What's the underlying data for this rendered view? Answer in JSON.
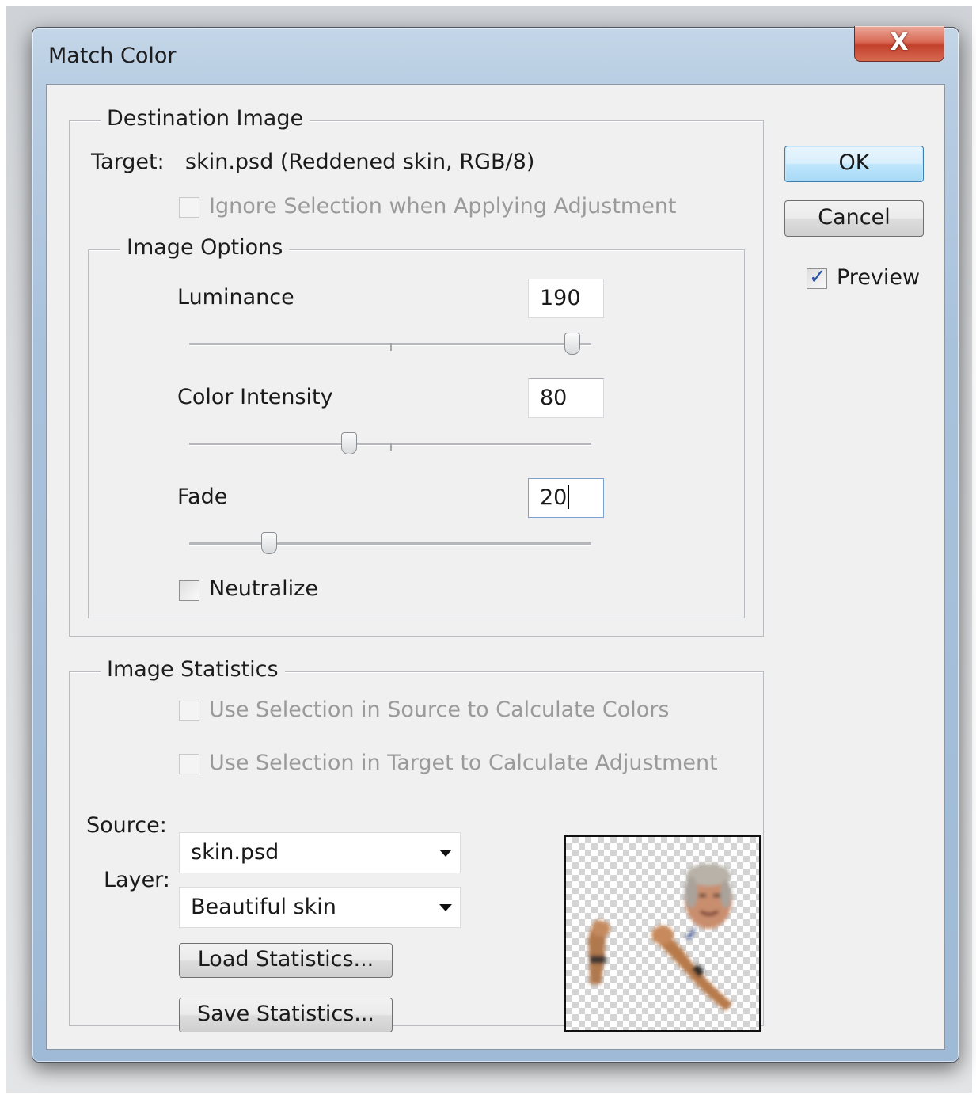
{
  "dialog": {
    "title": "Match Color",
    "close_glyph": "X",
    "ok_label": "OK",
    "cancel_label": "Cancel",
    "preview_label": "Preview",
    "preview_checked": true
  },
  "destination": {
    "legend": "Destination Image",
    "target_label": "Target:",
    "target_value": "skin.psd (Reddened skin, RGB/8)",
    "ignore_selection_label": "Ignore Selection when Applying Adjustment",
    "ignore_selection_enabled": false
  },
  "image_options": {
    "legend": "Image Options",
    "luminance": {
      "label": "Luminance",
      "value": "190",
      "slider_fraction": 0.95
    },
    "color_intensity": {
      "label": "Color Intensity",
      "value": "80",
      "slider_fraction": 0.4
    },
    "fade": {
      "label": "Fade",
      "value": "20",
      "slider_fraction": 0.2
    },
    "neutralize_label": "Neutralize",
    "neutralize_checked": false
  },
  "statistics": {
    "legend": "Image Statistics",
    "use_source_selection_label": "Use Selection in Source to Calculate Colors",
    "use_target_selection_label": "Use Selection in Target to Calculate Adjustment",
    "source_label": "Source:",
    "source_value": "skin.psd",
    "layer_label": "Layer:",
    "layer_value": "Beautiful skin",
    "load_button": "Load Statistics...",
    "save_button": "Save Statistics..."
  },
  "icons": {
    "close": "close-icon",
    "dropdown": "chevron-down-icon",
    "check": "checkmark-icon"
  },
  "colors": {
    "accent_blue": "#3c7fb1",
    "close_red": "#c2402c",
    "disabled_text": "#9a9a9a"
  }
}
